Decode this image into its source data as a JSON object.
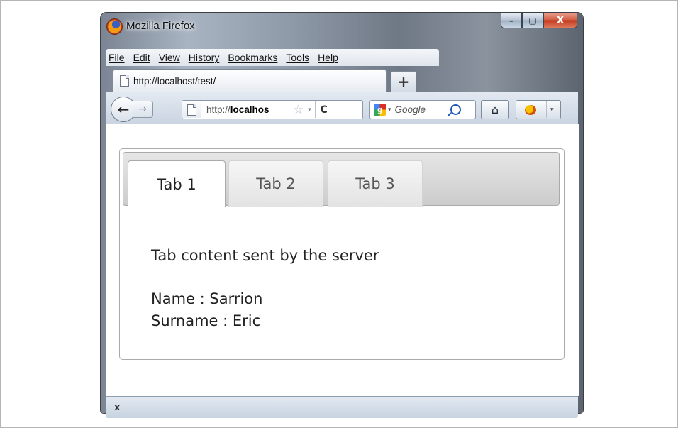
{
  "window": {
    "title": "Mozilla Firefox",
    "controls": {
      "minimize": "–",
      "maximize": "▢",
      "close": "X"
    }
  },
  "menubar": {
    "items": [
      "File",
      "Edit",
      "View",
      "History",
      "Bookmarks",
      "Tools",
      "Help"
    ]
  },
  "browser_tab": {
    "label": "http://localhost/test/",
    "new_tab": "+"
  },
  "navbar": {
    "back": "←",
    "forward": "→",
    "url_prefix": "http://",
    "url_host": "localhos",
    "star": "☆",
    "dropdown": "▾",
    "reload": "C",
    "search_placeholder": "Google",
    "search_engine_letter": "g",
    "home": "⌂",
    "addon_dropdown": "▾"
  },
  "jquery_tabs": {
    "tabs": [
      {
        "label": "Tab 1",
        "active": true
      },
      {
        "label": "Tab 2",
        "active": false
      },
      {
        "label": "Tab 3",
        "active": false
      }
    ],
    "panel": {
      "heading": "Tab content sent by the server",
      "name_line": "Name : Sarrion",
      "surname_line": "Surname : Eric"
    }
  },
  "statusbar": {
    "close_symbol": "x"
  },
  "colors": {
    "active_tab_bg": "#ffffff",
    "inactive_tab_bg": "#e6e6e6",
    "tab_nav_bg": "#cccccc",
    "close_button": "#c2381d"
  }
}
